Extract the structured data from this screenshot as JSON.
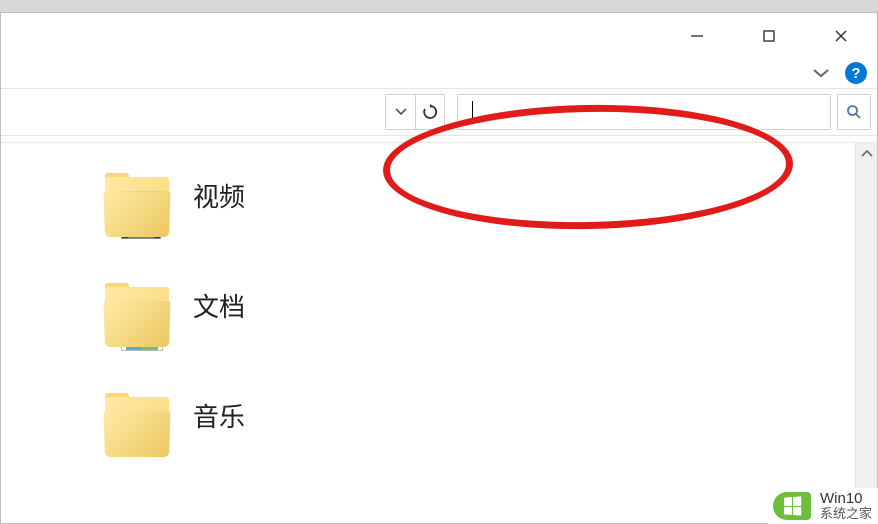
{
  "folders": [
    {
      "label": "视频",
      "type": "video"
    },
    {
      "label": "文档",
      "type": "doc"
    },
    {
      "label": "音乐",
      "type": "music"
    }
  ],
  "search": {
    "value": "",
    "placeholder": ""
  },
  "help_icon": "?",
  "watermark": {
    "title": "Win10",
    "sub": "系统之家"
  }
}
